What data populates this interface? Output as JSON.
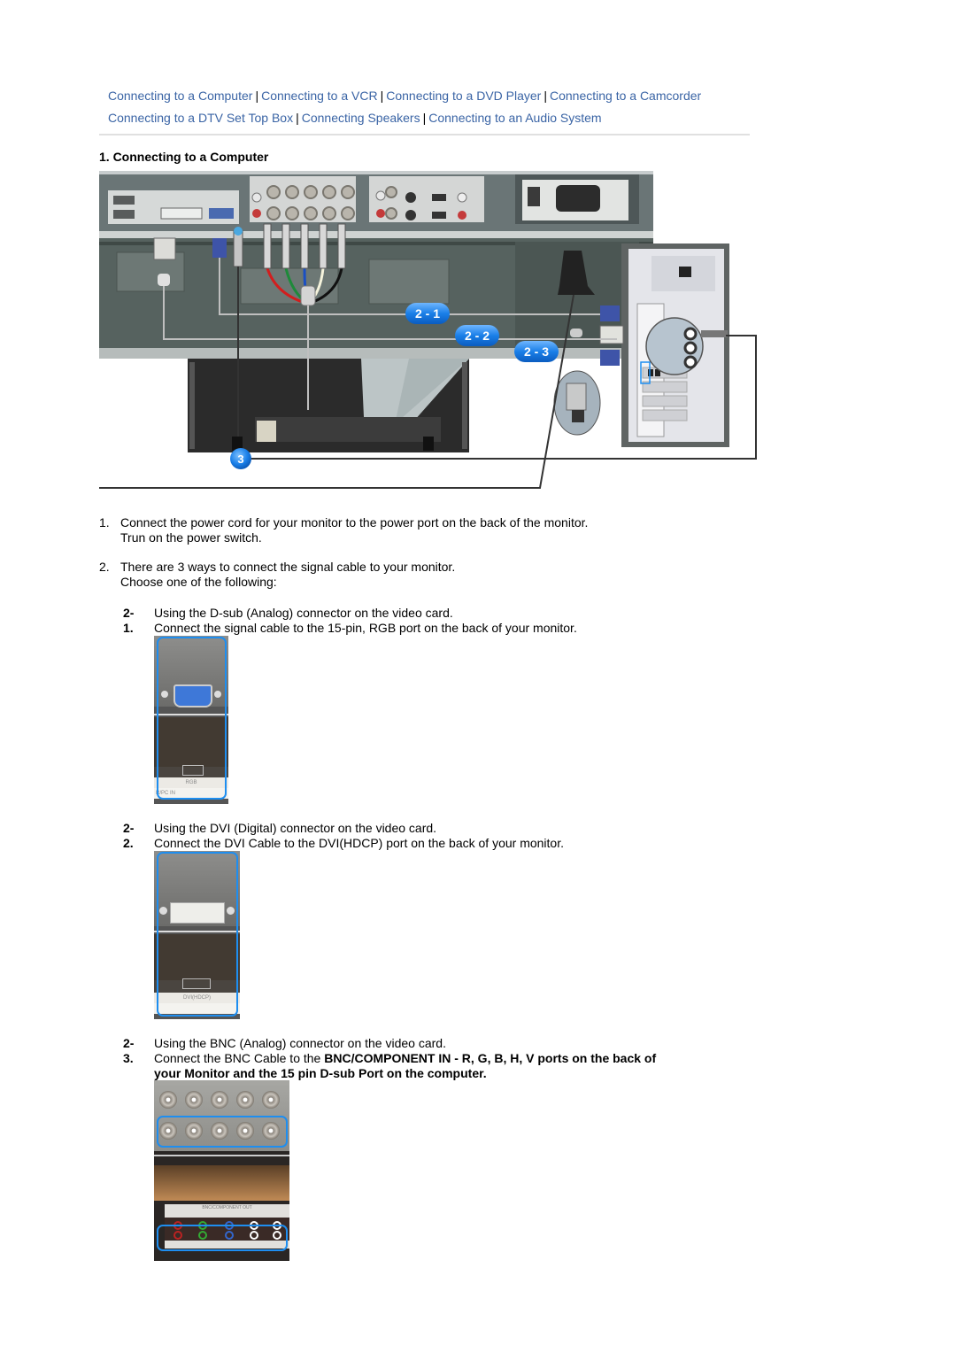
{
  "nav": {
    "links": [
      "Connecting to a Computer",
      "Connecting to a VCR",
      "Connecting to a DVD Player",
      "Connecting to a Camcorder",
      "Connecting to a DTV Set Top Box",
      "Connecting Speakers",
      "Connecting to an Audio System"
    ],
    "separator": "|"
  },
  "section": {
    "title": "1. Connecting to a Computer"
  },
  "diagram": {
    "callouts": [
      "2 - 1",
      "2 - 2",
      "2 - 3",
      "3"
    ],
    "accent_color": "#1a7fe8"
  },
  "steps": [
    {
      "number": "1.",
      "lines": [
        "Connect the power cord for your monitor to the power port on the back of the monitor.",
        "Trun on the power switch."
      ]
    },
    {
      "number": "2.",
      "lines": [
        "There are 3 ways to connect the signal cable to your monitor.",
        "Choose one of the following:"
      ]
    }
  ],
  "substeps": [
    {
      "number": "2-1.",
      "line1": "Using the D-sub (Analog) connector on the video card.",
      "line2": "Connect the signal cable to the 15-pin, RGB port on the back of your monitor.",
      "photo_labels": [
        "RGB",
        "R/PC IN"
      ]
    },
    {
      "number": "2-2.",
      "line1": "Using the DVI (Digital) connector on the video card.",
      "line2": "Connect the DVI Cable to the DVI(HDCP) port on the back of your monitor.",
      "photo_labels": [
        "DVI(HDCP)"
      ]
    },
    {
      "number": "2-3.",
      "line1": "Using the BNC (Analog) connector on the video card.",
      "line2_prefix": "Connect the BNC Cable to the ",
      "line2_bold": "BNC/COMPONENT IN - R, G, B, H, V ports on the back of",
      "line3_bold": "your Monitor and the 15 pin D-sub Port on the computer.",
      "photo_labels": [
        "BNC/COMPONENT OUT"
      ]
    }
  ]
}
